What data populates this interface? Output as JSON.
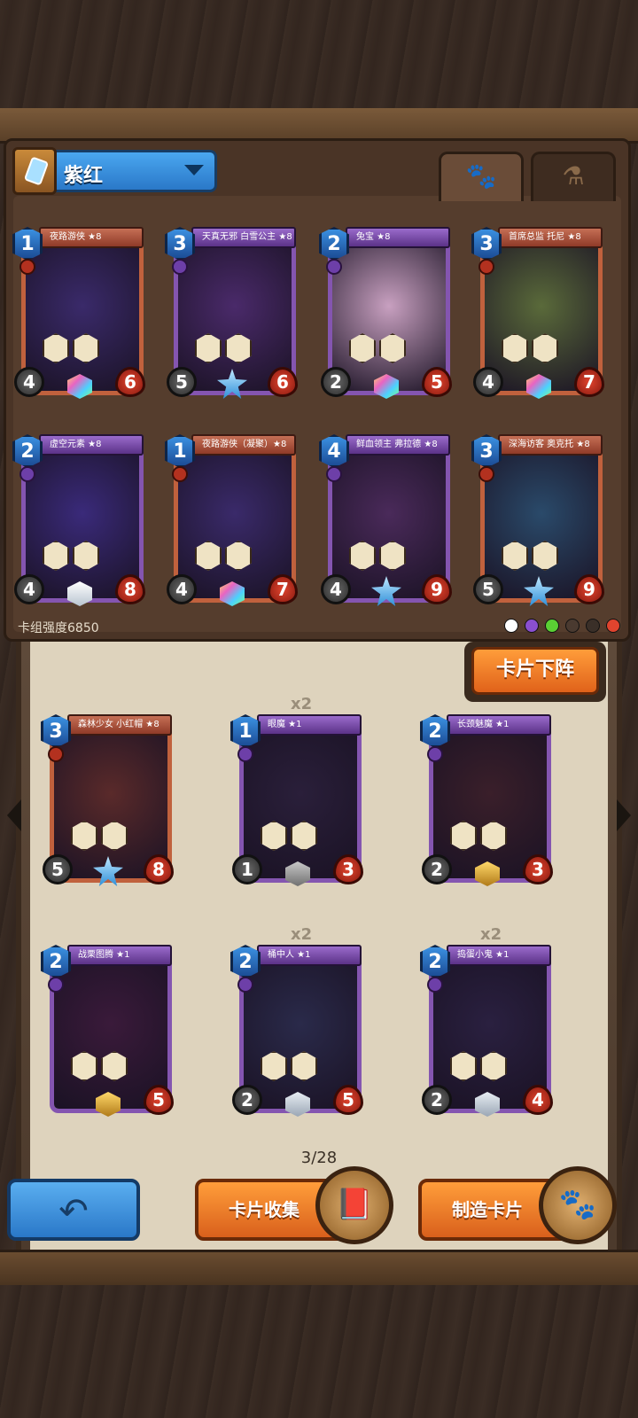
{
  "deck": {
    "name": "紫红",
    "power_label": "卡组强度6850",
    "tabs": [
      {
        "icon": "paw-icon",
        "glyph": "🐾",
        "active": true
      },
      {
        "icon": "potion-icon",
        "glyph": "⚗",
        "active": false
      }
    ],
    "cards": [
      {
        "cost": "1",
        "name": "夜路游侠 ★8",
        "atk": "4",
        "hp": "6",
        "frame": "red",
        "rarity": "rainbow"
      },
      {
        "cost": "3",
        "name": "天真无邪 白雪公主 ★8",
        "atk": "5",
        "hp": "6",
        "frame": "purple",
        "rarity": "star"
      },
      {
        "cost": "2",
        "name": "兔宝 ★8",
        "atk": "2",
        "hp": "5",
        "frame": "purple",
        "rarity": "rainbow"
      },
      {
        "cost": "3",
        "name": "首席总监 托尼 ★8",
        "atk": "4",
        "hp": "7",
        "frame": "red",
        "rarity": "rainbow"
      },
      {
        "cost": "2",
        "name": "虚空元素 ★8",
        "atk": "4",
        "hp": "8",
        "frame": "purple",
        "rarity": "white"
      },
      {
        "cost": "1",
        "name": "夜路游侠（凝聚）★8",
        "atk": "4",
        "hp": "7",
        "frame": "red",
        "rarity": "rainbow"
      },
      {
        "cost": "4",
        "name": "鲜血领主 弗拉德 ★8",
        "atk": "4",
        "hp": "9",
        "frame": "purple",
        "rarity": "star"
      },
      {
        "cost": "3",
        "name": "深海访客 奥克托 ★8",
        "atk": "5",
        "hp": "9",
        "frame": "red",
        "rarity": "star"
      }
    ]
  },
  "remove_button": "卡片下阵",
  "collection": [
    {
      "cost": "3",
      "name": "森林少女 小红帽 ★8",
      "atk": "5",
      "hp": "8",
      "frame": "red",
      "rarity": "star",
      "count": ""
    },
    {
      "cost": "1",
      "name": "眼魔 ★1",
      "atk": "1",
      "hp": "3",
      "frame": "purple",
      "rarity": "gray",
      "count": "x2"
    },
    {
      "cost": "2",
      "name": "长颈魅魔 ★1",
      "atk": "2",
      "hp": "3",
      "frame": "purple",
      "rarity": "gold",
      "count": ""
    },
    {
      "cost": "2",
      "name": "战栗图腾 ★1",
      "atk": "",
      "hp": "5",
      "frame": "purple",
      "rarity": "gold",
      "count": ""
    },
    {
      "cost": "2",
      "name": "桶中人 ★1",
      "atk": "2",
      "hp": "5",
      "frame": "purple",
      "rarity": "silver",
      "count": "x2"
    },
    {
      "cost": "2",
      "name": "捣蛋小鬼 ★1",
      "atk": "2",
      "hp": "4",
      "frame": "purple",
      "rarity": "silver",
      "count": "x2"
    }
  ],
  "page_indicator": "3/28",
  "bottom": {
    "back_icon": "back-arrow-icon",
    "collection_button": "卡片收集",
    "craft_button": "制造卡片"
  },
  "colors": {
    "accent_orange": "#e0621a",
    "accent_blue": "#2a78c8"
  }
}
